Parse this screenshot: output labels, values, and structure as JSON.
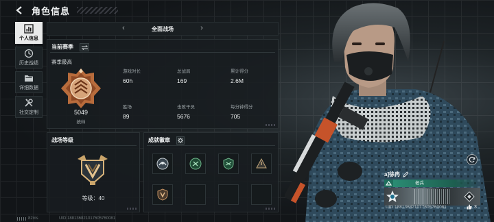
{
  "header": {
    "title": "角色信息"
  },
  "sidebar": {
    "items": [
      {
        "label": "个人信息",
        "icon": "bar-chart-icon",
        "active": true
      },
      {
        "label": "历史战绩",
        "icon": "clock-icon",
        "active": false
      },
      {
        "label": "详细数据",
        "icon": "folder-icon",
        "active": false
      },
      {
        "label": "社交定制",
        "icon": "tools-icon",
        "active": false
      }
    ]
  },
  "mode_selector": {
    "label": "全面战场",
    "prev": "‹",
    "next": "›"
  },
  "season_panel": {
    "title": "当前赛季",
    "subtitle": "赛季最高",
    "score": "5049",
    "rank_name": "统帅",
    "stats": [
      {
        "key": "游戏时长",
        "value": "60h"
      },
      {
        "key": "总战局",
        "value": "169"
      },
      {
        "key": "累计得分",
        "value": "2.6M"
      },
      {
        "key": "胜场",
        "value": "89"
      },
      {
        "key": "击败干员",
        "value": "5676"
      },
      {
        "key": "每分钟得分",
        "value": "705"
      }
    ]
  },
  "rank_panel": {
    "title": "战场等级",
    "level_text": "等级：40"
  },
  "badge_panel": {
    "title": "成就徽章",
    "badges": [
      {
        "icon": "laurel-badge-icon",
        "filled": true
      },
      {
        "icon": "green-shield-badge-icon",
        "filled": true
      },
      {
        "icon": "green-shield-badge-icon",
        "filled": true
      },
      {
        "icon": "dark-triangle-badge-icon",
        "filled": true
      },
      {
        "icon": "bronze-shield-badge-icon",
        "filled": true
      },
      {
        "icon": "",
        "filled": false
      },
      {
        "icon": "",
        "filled": false
      },
      {
        "icon": "",
        "filled": false
      }
    ]
  },
  "player": {
    "name": "a]徐冉",
    "tag": "老兵",
    "uid": "UID:188136821017605760081",
    "likes": "3"
  },
  "footer": {
    "uid": "UID:188136821017605760081",
    "ping": "82ms"
  },
  "colors": {
    "accent_green": "#2a8c73",
    "panel_bg": "#181d20",
    "active_tab": "#e9eaea"
  }
}
